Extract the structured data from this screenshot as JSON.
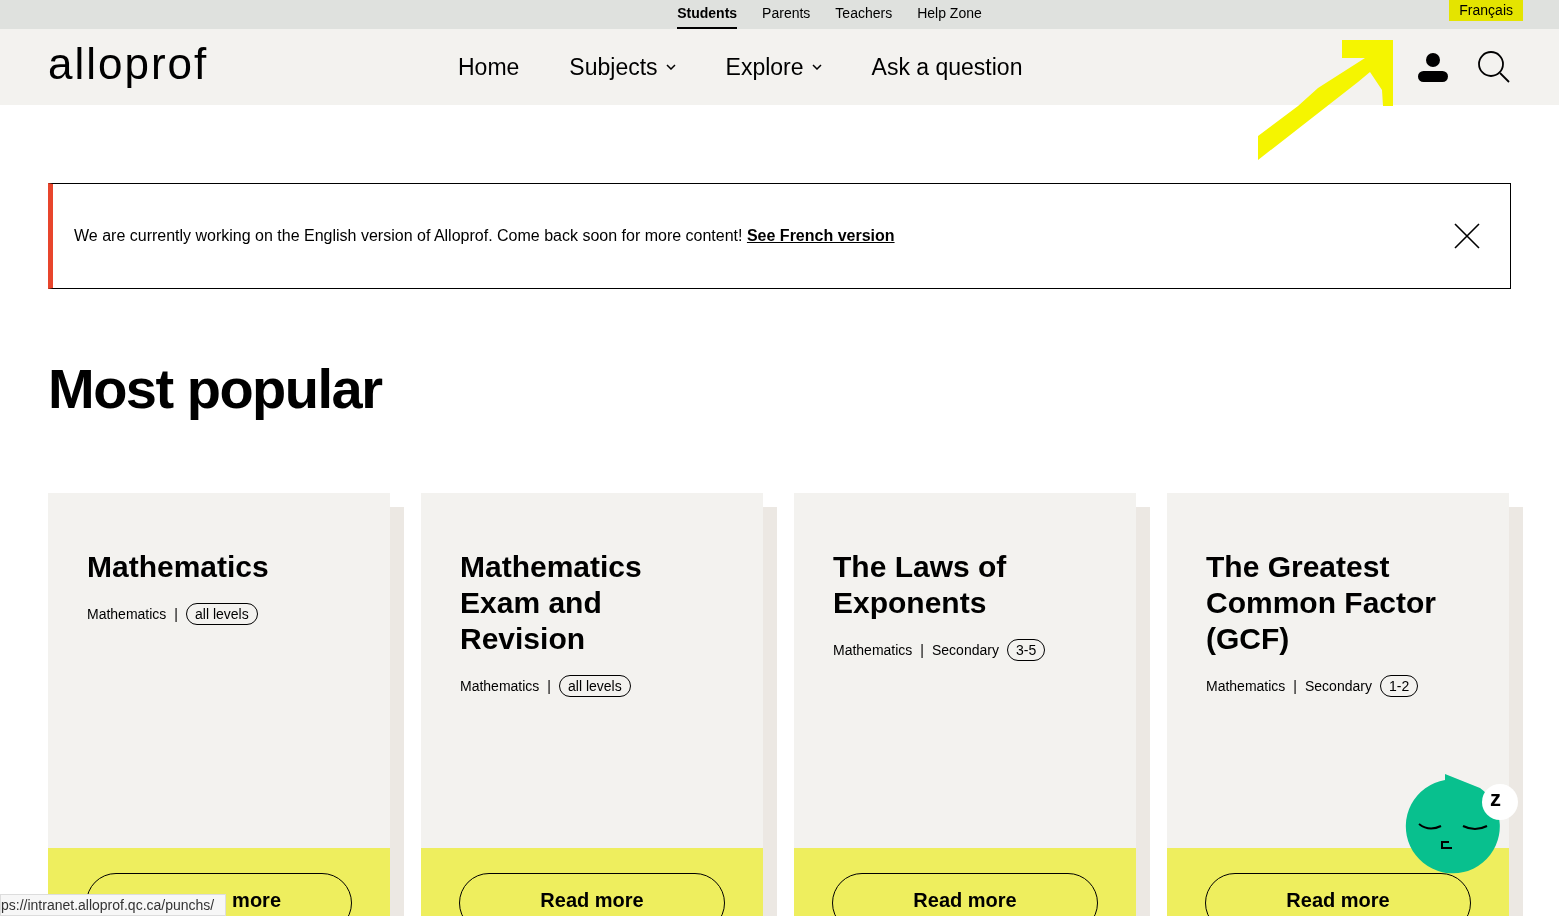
{
  "top_links": [
    {
      "label": "Students",
      "selected": true
    },
    {
      "label": "Parents",
      "selected": false
    },
    {
      "label": "Teachers",
      "selected": false
    },
    {
      "label": "Help Zone",
      "selected": false
    }
  ],
  "language": "Français",
  "logo": "alloprof",
  "nav": [
    {
      "label": "Home",
      "dropdown": false
    },
    {
      "label": "Subjects",
      "dropdown": true
    },
    {
      "label": "Explore",
      "dropdown": true
    },
    {
      "label": "Ask a question",
      "dropdown": false
    }
  ],
  "notice": {
    "text": "We are currently working on the English version of Alloprof. Come back soon for more content!",
    "link": "See French version"
  },
  "heading": "Most popular",
  "cards": [
    {
      "title": "Mathematics",
      "subject": "Mathematics",
      "separator": "|",
      "grade": "all levels",
      "button": "more"
    },
    {
      "title": "Mathematics Exam and Revision",
      "subject": "Mathematics",
      "separator": "|",
      "grade": "all levels",
      "button": "Read more"
    },
    {
      "title": "The Laws of Exponents",
      "subject": "Mathematics",
      "separator": "|",
      "level": "Secondary",
      "grade": "3-5",
      "button": "Read more"
    },
    {
      "title": "The Greatest Common Factor (GCF)",
      "subject": "Mathematics",
      "separator": "|",
      "level": "Secondary",
      "grade": "1-2",
      "button": "Read more"
    }
  ],
  "mascot_badge": "z",
  "status_url": "ps://intranet.alloprof.qc.ca/punchs/"
}
